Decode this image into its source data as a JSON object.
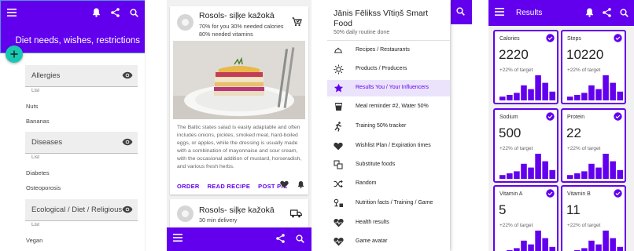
{
  "colors": {
    "primary": "#6200ee",
    "fab": "#18c8b2",
    "active_bg": "#ebe3fc"
  },
  "screen1": {
    "title": "Diet needs, wishes, restrictions",
    "icons": [
      "menu-icon",
      "bell-icon",
      "share-icon",
      "search-icon",
      "plus-icon"
    ],
    "sections": [
      {
        "label": "Allergies",
        "sub": "List",
        "items": [
          "Nuts",
          "Bananas"
        ]
      },
      {
        "label": "Diseases",
        "sub": "List",
        "items": [
          "Diabetes",
          "Osteoporosis"
        ]
      },
      {
        "label": "Ecological / Diet / Religious",
        "sub": "List",
        "items": [
          "Vegan"
        ]
      }
    ]
  },
  "screen2": {
    "card1": {
      "title": "Rosols- siļķe kažokā",
      "line1": "70% for you 30% needed calories",
      "line2": "80% needed vitamins",
      "body": "The Baltic states salad is easily adaptable and often includes onions, pickles, smoked meat, hard-boiled eggs, or apples, while the dressing is usually made with a combination of mayonnaise and sour cream, with the occasional addition of mustard, horseradish, and various fresh herbs.",
      "actions": [
        "ORDER",
        "READ RECIPE",
        "POST PIC"
      ]
    },
    "card2": {
      "title": "Rosols- siļķe kažokā",
      "line1": "30 min delivery"
    }
  },
  "screen3": {
    "name_line1": "Jānis Fēlikss Vītiņš Smart",
    "name_line2": "Food",
    "subtitle": "50% daily routine done",
    "items": [
      {
        "label": "Recipes / Restaurants",
        "icon": "cloche-icon"
      },
      {
        "label": "Products / Producers",
        "icon": "sun-icon"
      },
      {
        "label": "Results You / Your Influencers",
        "icon": "star-icon",
        "active": true
      },
      {
        "label": "Meal reminder #2, Water 50%",
        "icon": "cup-icon"
      },
      {
        "label": "Training 50% tracker",
        "icon": "running-icon"
      },
      {
        "label": "Wishlist Plan / Expiration times",
        "icon": "heart-icon"
      },
      {
        "label": "Substitute foods",
        "icon": "swap-icon"
      },
      {
        "label": "Random",
        "icon": "shuffle-icon"
      },
      {
        "label": "Nutrition facts / Training / Game",
        "icon": "nutrition-icon"
      },
      {
        "label": "Health results",
        "icon": "pulse-heart-icon"
      },
      {
        "label": "Game avatar",
        "icon": "avatar-heart-icon"
      }
    ]
  },
  "screen4": {
    "title": "Results",
    "stats": [
      {
        "label": "Calories",
        "value": "2220",
        "target": "+22% of target",
        "bars": [
          0.15,
          0.22,
          0.3,
          0.6,
          0.45,
          1.0,
          0.7,
          0.35
        ]
      },
      {
        "label": "Steps",
        "value": "10220",
        "target": "+22% of target",
        "bars": [
          0.15,
          0.22,
          0.3,
          0.6,
          0.45,
          1.0,
          0.7,
          0.35
        ]
      },
      {
        "label": "Sodium",
        "value": "500",
        "target": "+22% of target",
        "bars": [
          0.15,
          0.22,
          0.3,
          0.6,
          0.45,
          1.0,
          0.7,
          0.35
        ]
      },
      {
        "label": "Protein",
        "value": "22",
        "target": "+22% of target",
        "bars": [
          0.15,
          0.22,
          0.3,
          0.6,
          0.45,
          1.0,
          0.7,
          0.35
        ]
      },
      {
        "label": "Vitamin A",
        "value": "5",
        "target": "+22% of target",
        "bars": [
          0.15,
          0.22,
          0.3,
          0.6,
          0.45,
          1.0,
          0.7,
          0.35
        ]
      },
      {
        "label": "Vitamin B",
        "value": "11",
        "target": "+22% of target",
        "bars": [
          0.15,
          0.22,
          0.3,
          0.6,
          0.45,
          1.0,
          0.7,
          0.35
        ]
      }
    ]
  }
}
